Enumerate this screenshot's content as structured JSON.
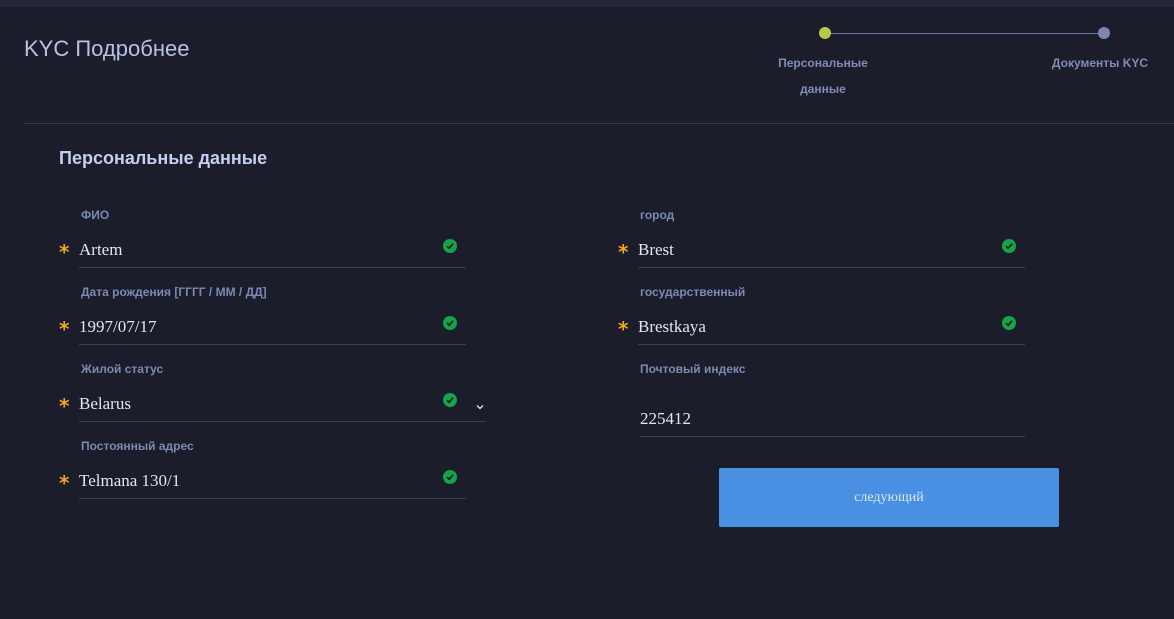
{
  "header": {
    "title": "KYC Подробнее"
  },
  "stepper": {
    "steps": [
      {
        "label_line1": "Персональные",
        "label_line2": "данные",
        "status": "active"
      },
      {
        "label_line1": "Документы KYC",
        "label_line2": "",
        "status": "pending"
      }
    ]
  },
  "section": {
    "title": "Персональные данные"
  },
  "form": {
    "full_name": {
      "label": "ФИО",
      "value": "Artem",
      "required": "*"
    },
    "birth_date": {
      "label": "Дата рождения [ГГГГ / ММ / ДД]",
      "value": "1997/07/17",
      "required": "*"
    },
    "residency": {
      "label": "Жилой статус",
      "value": "Belarus",
      "required": "*"
    },
    "address": {
      "label": "Постоянный адрес",
      "value": "Telmana 130/1",
      "required": "*"
    },
    "city": {
      "label": "город",
      "value": "Brest",
      "required": "*"
    },
    "state": {
      "label": "государственный",
      "value": "Brestkaya",
      "required": "*"
    },
    "postal_code": {
      "label": "Почтовый индекс",
      "value": "225412"
    }
  },
  "actions": {
    "next_label": "следующий"
  },
  "colors": {
    "background": "#1c1d2b",
    "accent": "#4a90e2",
    "required": "#f3a51c",
    "valid": "#16a34a",
    "active_step": "#b8c84a"
  }
}
